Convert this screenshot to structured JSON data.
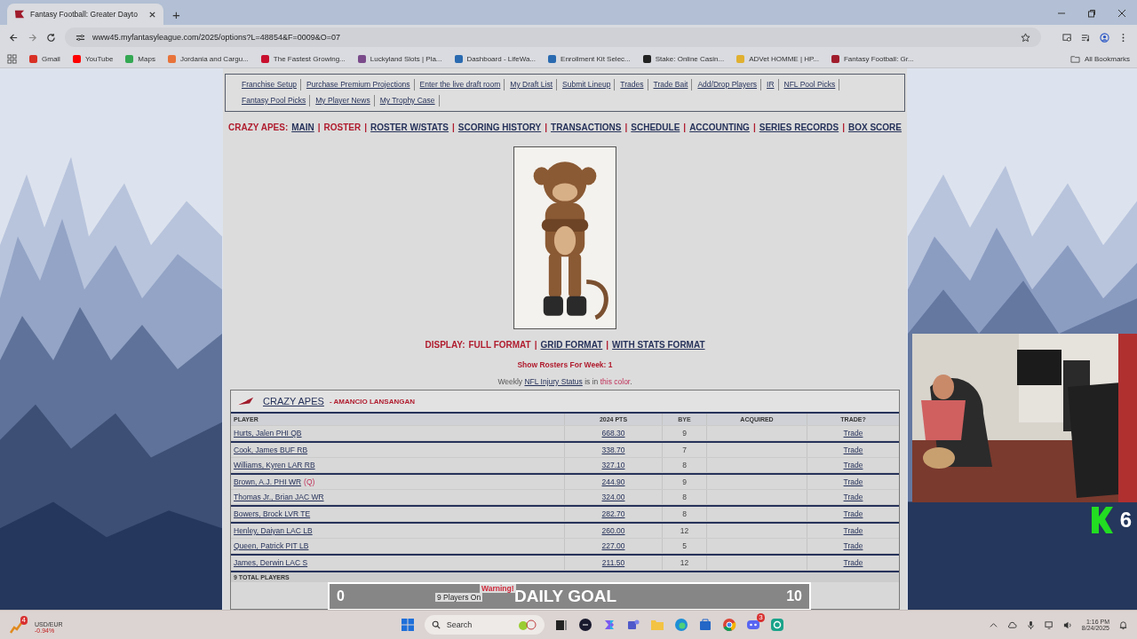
{
  "browser": {
    "tab_title": "Fantasy Football: Greater Dayto",
    "new_tab": "+",
    "url": "www45.myfantasyleague.com/2025/options?L=48854&F=0009&O=07",
    "bookmarks": [
      {
        "label": "Gmail",
        "color": "#d93025"
      },
      {
        "label": "YouTube",
        "color": "#ff0000"
      },
      {
        "label": "Maps",
        "color": "#34a853"
      },
      {
        "label": "Jordania and Cargu...",
        "color": "#e8733a"
      },
      {
        "label": "The Fastest Growing...",
        "color": "#c8102e"
      },
      {
        "label": "Luckyland Slots | Pla...",
        "color": "#7a4a8a"
      },
      {
        "label": "Dashboard - LifeWa...",
        "color": "#2a6ab0"
      },
      {
        "label": "Enrollment Kit Selec...",
        "color": "#2a6ab0"
      },
      {
        "label": "Stake: Online Casin...",
        "color": "#222222"
      },
      {
        "label": "ADVet HOMME | HP...",
        "color": "#e0b030"
      },
      {
        "label": "Fantasy Football: Gr...",
        "color": "#a01c2c"
      }
    ],
    "all_bookmarks": "All Bookmarks"
  },
  "nav_links": [
    "Franchise Setup",
    "Purchase Premium Projections",
    "Enter the live draft room",
    "My Draft List",
    "Submit Lineup",
    "Trades",
    "Trade Bait",
    "Add/Drop Players",
    "IR",
    "NFL Pool Picks",
    "Fantasy Pool Picks",
    "My Player News",
    "My Trophy Case"
  ],
  "team_nav": {
    "label": "CRAZY APES:",
    "separator": "|",
    "links": [
      {
        "label": "MAIN",
        "selected": false
      },
      {
        "label": "ROSTER",
        "selected": true
      },
      {
        "label": "ROSTER W/STATS",
        "selected": false
      },
      {
        "label": "SCORING HISTORY",
        "selected": false
      },
      {
        "label": "TRANSACTIONS",
        "selected": false
      },
      {
        "label": "SCHEDULE",
        "selected": false
      },
      {
        "label": "ACCOUNTING",
        "selected": false
      },
      {
        "label": "SERIES RECORDS",
        "selected": false
      },
      {
        "label": "BOX SCORE",
        "selected": false
      }
    ]
  },
  "display": {
    "label": "DISPLAY:",
    "separator": "|",
    "options": [
      {
        "label": "FULL FORMAT",
        "selected": true
      },
      {
        "label": "GRID FORMAT",
        "selected": false
      },
      {
        "label": "WITH STATS FORMAT",
        "selected": false
      }
    ]
  },
  "week_line": "Show Rosters For Week: 1",
  "injury_note": {
    "prefix": "Weekly",
    "link": "NFL Injury Status",
    "middle": "is in",
    "colored": "this color",
    "suffix": "."
  },
  "roster": {
    "team": "CRAZY APES",
    "owner": "- AMANCIO LANSANGAN",
    "columns": [
      "PLAYER",
      "2024 PTS",
      "BYE",
      "ACQUIRED",
      "TRADE?"
    ],
    "groups": [
      {
        "rows": [
          {
            "player": "Hurts, Jalen PHI QB",
            "pts": "668.30",
            "bye": "9",
            "trade": "Trade"
          }
        ]
      },
      {
        "rows": [
          {
            "player": "Cook, James BUF RB",
            "pts": "338.70",
            "bye": "7",
            "trade": "Trade"
          },
          {
            "player": "Williams, Kyren LAR RB",
            "pts": "327.10",
            "bye": "8",
            "trade": "Trade"
          }
        ]
      },
      {
        "rows": [
          {
            "player": "Brown, A.J. PHI WR",
            "injury": "(Q)",
            "pts": "244.90",
            "bye": "9",
            "trade": "Trade"
          },
          {
            "player": "Thomas Jr., Brian JAC WR",
            "pts": "324.00",
            "bye": "8",
            "trade": "Trade"
          }
        ]
      },
      {
        "rows": [
          {
            "player": "Bowers, Brock LVR TE",
            "pts": "282.70",
            "bye": "8",
            "trade": "Trade"
          }
        ]
      },
      {
        "rows": [
          {
            "player": "Henley, Daiyan LAC LB",
            "pts": "260.00",
            "bye": "12",
            "trade": "Trade"
          },
          {
            "player": "Queen, Patrick PIT LB",
            "pts": "227.00",
            "bye": "5",
            "trade": "Trade"
          }
        ]
      },
      {
        "rows": [
          {
            "player": "James, Derwin LAC S",
            "pts": "211.50",
            "bye": "12",
            "trade": "Trade"
          }
        ]
      }
    ],
    "total": "9 TOTAL PLAYERS",
    "warning": {
      "label": "Warning!",
      "line_2": "9 Players On"
    }
  },
  "daily_goal": {
    "min": "0",
    "label": "DAILY GOAL",
    "max": "10"
  },
  "stream_badge": {
    "count": "6"
  },
  "taskbar": {
    "widget_badge": "4",
    "ticker": "USD/EUR",
    "change": "-0.94%",
    "search": "Search",
    "chat_badge": "3",
    "time": "1:16 PM",
    "date": "8/24/2025"
  }
}
